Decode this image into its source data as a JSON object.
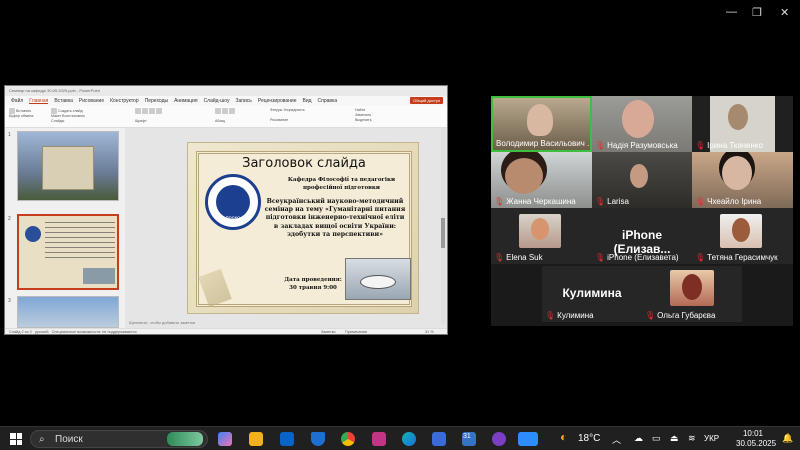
{
  "window_controls": {
    "minimize": "—",
    "restore": "❐",
    "close": "✕"
  },
  "ppt": {
    "title": "Семінар на кафедрі 30.05.2025.pptx - PowerPoint",
    "menu": [
      "Файл",
      "Главная",
      "Вставка",
      "Рисование",
      "Конструктор",
      "Переходы",
      "Анимация",
      "Слайд-шоу",
      "Запись",
      "Рецензирование",
      "Вид",
      "Справка"
    ],
    "share_label": "Общий доступ",
    "ribbon_groups": [
      "Буфер обмена",
      "Слайды",
      "Шрифт",
      "Абзац",
      "Рисование",
      "Редактирование"
    ],
    "ribbon_items": {
      "paste": "Вставить",
      "new_slide": "Создать слайд",
      "macet": "Макет",
      "restore": "Восстановить",
      "section": "Раздел",
      "shapes": "Фигуры",
      "arrange": "Упорядочить",
      "find": "Найти",
      "replace": "Заменить",
      "select": "Выделить"
    },
    "thumb_numbers": [
      "1",
      "2",
      "3"
    ],
    "slide": {
      "header": "Заголовок слайда",
      "dept": "Кафедра Філософії та педагогіки професійної підготовки",
      "title": "Всеукраїнський науково-методичний семінар на тему «Гуманітарні питання підготовки інженерно-технічної еліти в закладах вищої освіти України: здобутки та перспективи»",
      "date_label": "Дата проведення:",
      "date_value": "30 травня 9:00",
      "logo_text": "ПОСКО"
    },
    "notes_placeholder": "Щелкните, чтобы добавить заметки",
    "status_left": "Слайд 2 из 3",
    "status_lang": "русский",
    "status_access": "Специальные возможности: не поддерживается",
    "status_notes": "Заметки",
    "status_comments": "Примечания",
    "status_zoom": "31 %"
  },
  "participants": [
    {
      "name": "Володимир Васильович ...",
      "muted": false,
      "video": true,
      "active": true
    },
    {
      "name": "Надія Разумовська",
      "muted": true,
      "video": true
    },
    {
      "name": "Ірина Ткаченко",
      "muted": true,
      "video": true
    },
    {
      "name": "Жанна Черкашина",
      "muted": true,
      "video": true
    },
    {
      "name": "Larisa",
      "muted": true,
      "video": true
    },
    {
      "name": "Чхеайло Ірина",
      "muted": true,
      "video": true
    },
    {
      "name": "Elena Suk",
      "muted": true,
      "video": false
    },
    {
      "name": "iPhone (Елизавета)",
      "muted": true,
      "video": false,
      "big": "iPhone  (Елизав..."
    },
    {
      "name": "Тетяна Герасимчук",
      "muted": true,
      "video": false
    },
    {
      "name": "Кулимина",
      "muted": true,
      "video": false,
      "big": "Кулимина"
    },
    {
      "name": "Ольга Губарєва",
      "muted": true,
      "video": false
    }
  ],
  "taskbar": {
    "search_placeholder": "Поиск",
    "weather": "18°C",
    "lang": "УКР",
    "time": "10:01",
    "date": "30.05.2025",
    "badge": "31"
  },
  "colors": {
    "accent": "#c43e1c",
    "active_speaker": "#3fbf3f",
    "muted": "#e03030"
  }
}
